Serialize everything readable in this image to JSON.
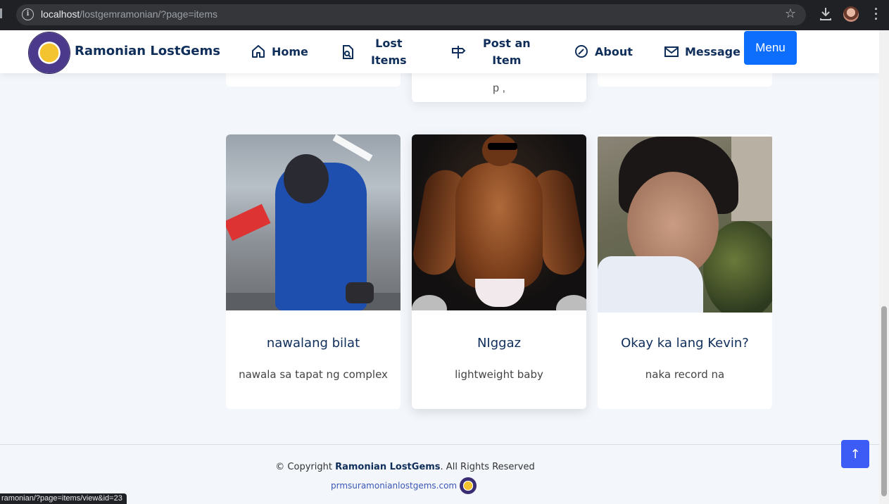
{
  "browser": {
    "url_host": "localhost",
    "url_path": "/lostgemramonian/?page=items",
    "status_url": "ramonian/?page=items/view&id=23"
  },
  "header": {
    "brand": "Ramonian LostGems",
    "nav": [
      {
        "label": "Home",
        "icon": "home-icon"
      },
      {
        "label_line1": "Lost",
        "label_line2": "Items",
        "icon": "search-document-icon"
      },
      {
        "label_line1": "Post an",
        "label_line2": "Item",
        "icon": "signpost-icon"
      },
      {
        "label": "About",
        "icon": "about-icon"
      },
      {
        "label": "Message",
        "icon": "envelope-icon"
      }
    ],
    "menu_label": "Menu",
    "accent": "#0d6efd"
  },
  "top_partial": {
    "middle_text": "p ,"
  },
  "items": [
    {
      "title": "nawalang bilat",
      "desc": "nawala sa tapat ng complex"
    },
    {
      "title": "NIggaz",
      "desc": "lightweight baby"
    },
    {
      "title": "Okay ka lang Kevin?",
      "desc": "naka record na"
    }
  ],
  "footer": {
    "copyright_prefix": "© Copyright ",
    "copyright_brand": "Ramonian LostGems",
    "copyright_suffix": ". All Rights Reserved",
    "site": "prmsuramonianlostgems.com",
    "to_top_icon": "arrow-up-icon"
  }
}
